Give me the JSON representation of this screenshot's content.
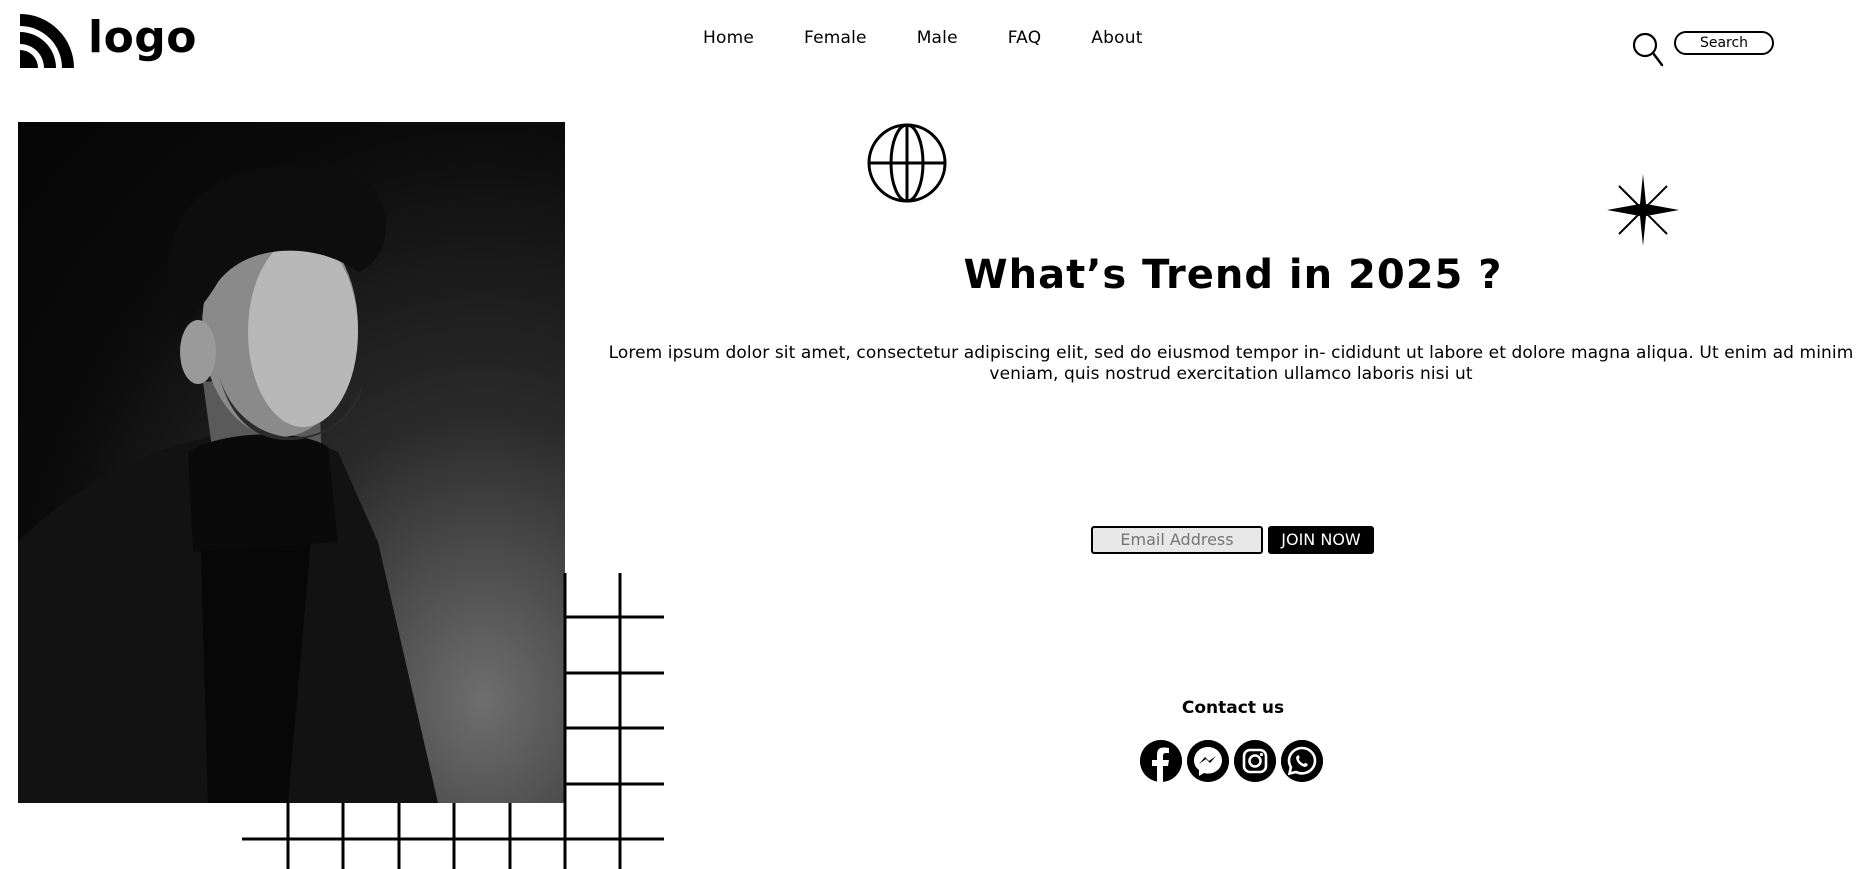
{
  "header": {
    "logo_text": "logo",
    "nav": [
      "Home",
      "Female",
      "Male",
      "FAQ",
      "About"
    ],
    "search_label": "Search"
  },
  "hero": {
    "image_alt": "Black and white portrait of a man in a dark turtleneck and blazer",
    "headline": "What’s Trend in 2025 ?",
    "description": "Lorem ipsum dolor sit amet, consectetur adipiscing elit, sed do eiusmod tempor in- cididunt ut labore et dolore magna aliqua. Ut enim ad minim veniam, quis nostrud exercitation ullamco laboris nisi ut"
  },
  "signup": {
    "email_placeholder": "Email Address",
    "join_label": "JOIN NOW"
  },
  "contact": {
    "title": "Contact us",
    "icons": [
      "facebook-icon",
      "messenger-icon",
      "instagram-icon",
      "whatsapp-icon"
    ]
  },
  "colors": {
    "primary": "#000000",
    "background": "#ffffff",
    "input_bg": "#e8e8e8"
  }
}
